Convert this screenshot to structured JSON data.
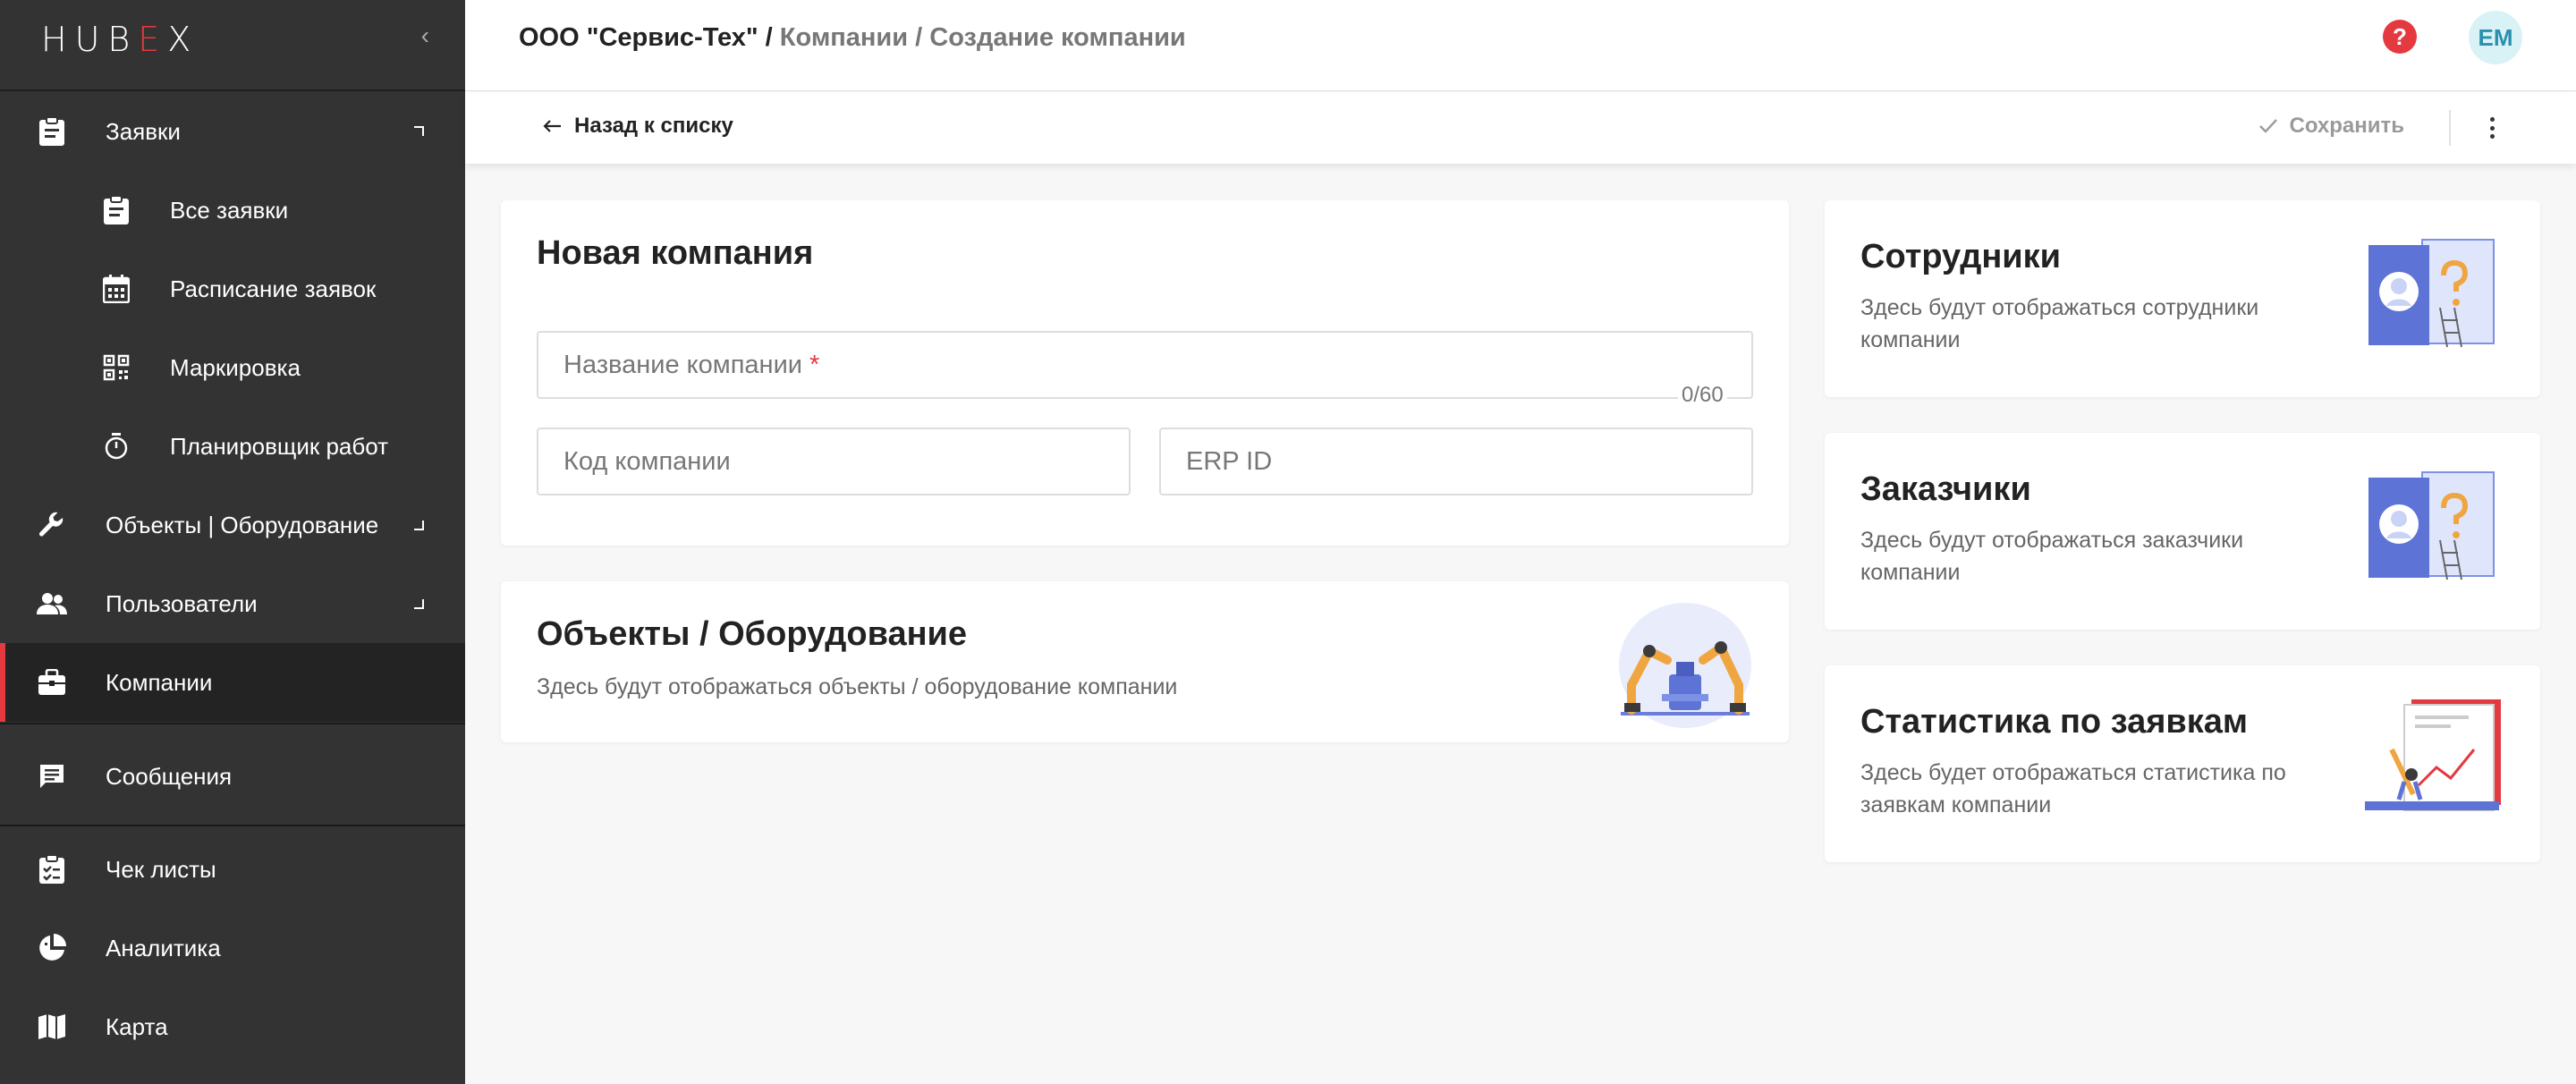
{
  "sidebar": {
    "logo_left": "HUB",
    "logo_accent": "E",
    "logo_right": "X",
    "collapse_glyph": "‹",
    "items": [
      {
        "label": "Заявки",
        "icon": "clipboard-icon"
      },
      {
        "label": "Все заявки",
        "icon": "clipboard-icon"
      },
      {
        "label": "Расписание заявок",
        "icon": "calendar-icon"
      },
      {
        "label": "Маркировка",
        "icon": "qr-code-icon"
      },
      {
        "label": "Планировщик работ",
        "icon": "timer-icon"
      },
      {
        "label": "Объекты | Оборудование",
        "icon": "wrench-icon"
      },
      {
        "label": "Пользователи",
        "icon": "users-icon"
      },
      {
        "label": "Компании",
        "icon": "briefcase-icon"
      },
      {
        "label": "Сообщения",
        "icon": "message-icon"
      },
      {
        "label": "Чек листы",
        "icon": "checklist-icon"
      },
      {
        "label": "Аналитика",
        "icon": "pie-chart-icon"
      },
      {
        "label": "Карта",
        "icon": "map-icon"
      }
    ]
  },
  "topbar": {
    "company": "ООО \"Сервис-Тех\" /",
    "path": "Компании / Создание компании",
    "help_glyph": "?",
    "avatar_initials": "EM"
  },
  "subbar": {
    "back_label": "Назад к списку",
    "save_label": "Сохранить"
  },
  "form": {
    "title": "Новая компания",
    "name_placeholder": "Название компании",
    "name_required": "*",
    "name_counter": "0/60",
    "code_placeholder": "Код компании",
    "erp_placeholder": "ERP ID"
  },
  "objects_card": {
    "title": "Объекты / Оборудование",
    "text": "Здесь будут отображаться объекты / оборудование компании"
  },
  "side_cards": [
    {
      "title": "Сотрудники",
      "text": "Здесь будут отображаться сотрудники компании"
    },
    {
      "title": "Заказчики",
      "text": "Здесь будут отображаться заказчики компании"
    },
    {
      "title": "Статистика по заявкам",
      "text": "Здесь будет отображаться статистика по заявкам компании"
    }
  ],
  "colors": {
    "accent": "#e53940",
    "sidebar": "#333333",
    "avatar_bg": "#d8f2f6"
  }
}
